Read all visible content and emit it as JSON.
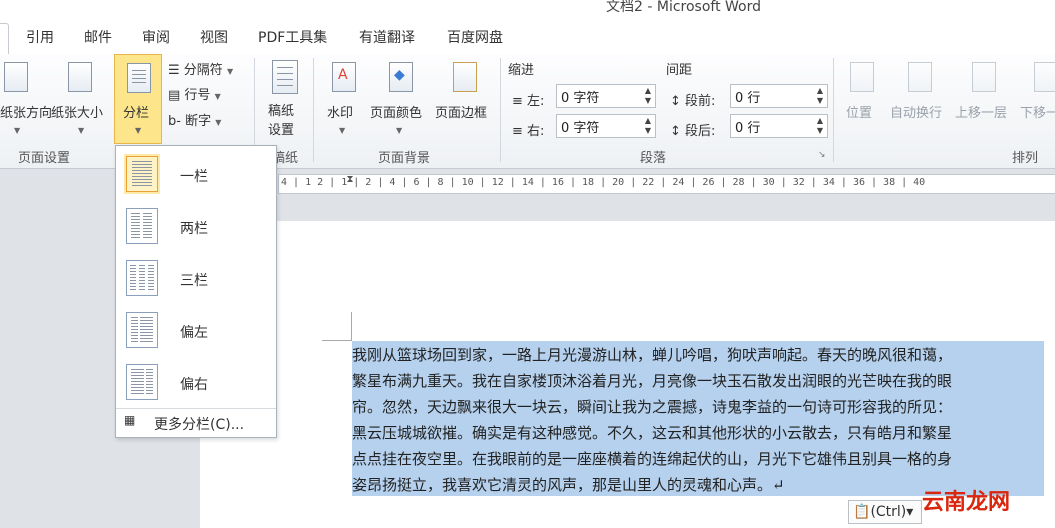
{
  "window": {
    "title": "文档2 - Microsoft Word"
  },
  "tabs": [
    "引用",
    "邮件",
    "审阅",
    "视图",
    "PDF工具集",
    "有道翻译",
    "百度网盘"
  ],
  "ribbon": {
    "page_setup": {
      "group_label": "页面设置",
      "orientation_label": "纸张方向",
      "size_label": "纸张大小",
      "columns_label": "分栏",
      "breaks_label": "分隔符",
      "line_numbers_label": "行号",
      "hyphenation_label": "断字"
    },
    "manuscript": {
      "group_label": "稿纸",
      "button_label": "稿纸设置"
    },
    "page_background": {
      "group_label": "页面背景",
      "watermark_label": "水印",
      "page_color_label": "页面颜色",
      "page_border_label": "页面边框"
    },
    "paragraph": {
      "group_label": "段落",
      "indent_title": "缩进",
      "spacing_title": "间距",
      "indent_left_label": "左:",
      "indent_left_value": "0 字符",
      "indent_right_label": "右:",
      "indent_right_value": "0 字符",
      "spacing_before_label": "段前:",
      "spacing_before_value": "0 行",
      "spacing_after_label": "段后:",
      "spacing_after_value": "0 行"
    },
    "arrange": {
      "group_label": "排列",
      "position_label": "位置",
      "wrap_label": "自动换行",
      "bring_forward_label": "上移一层",
      "send_backward_label": "下移一"
    }
  },
  "ruler_text": "4 | 1 2 | 1 | 2 | 4 | 6 | 8 | 10 | 12 | 14 | 16 | 18 | 20 | 22 | 24 | 26 | 28 | 30 | 32 | 34 | 36 | 38 | 40",
  "columns_menu": {
    "items": [
      "一栏",
      "两栏",
      "三栏",
      "偏左",
      "偏右"
    ],
    "selected": "一栏",
    "more_label": "更多分栏(C)..."
  },
  "document": {
    "lines": [
      "我刚从篮球场回到家，一路上月光漫游山林，蝉儿吟唱，狗吠声响起。春天的晚风很和蔼，",
      "繁星布满九重天。我在自家楼顶沐浴着月光，月亮像一块玉石散发出润眼的光芒映在我的眼",
      "帘。忽然，天边飘来很大一块云，瞬间让我为之震撼，诗鬼李益的一句诗可形容我的所见：",
      "黑云压城城欲摧。确实是有这种感觉。不久，这云和其他形状的小云散去，只有皓月和繁星",
      "点点挂在夜空里。在我眼前的是一座座横着的连绵起伏的山，月光下它雄伟且别具一格的身",
      "姿昂扬挺立，我喜欢它清灵的风声，那是山里人的灵魂和心声。↵"
    ]
  },
  "paste_options": {
    "label": "(Ctrl)▾"
  },
  "watermark_text": "云南龙网",
  "colors": {
    "highlight": "#b5d1ee",
    "selected_border": "#e9a23b",
    "watermark": "#d9260d"
  }
}
